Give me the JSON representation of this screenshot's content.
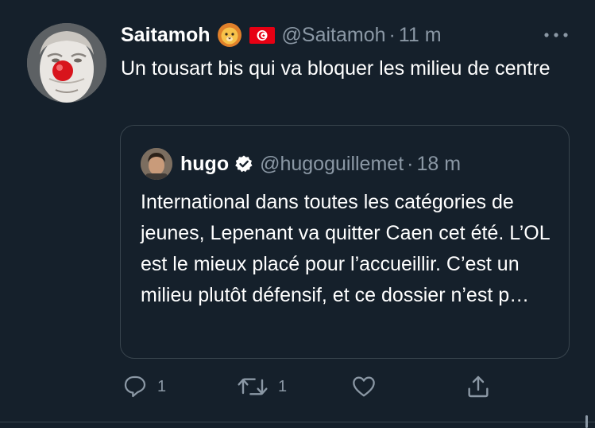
{
  "tweet": {
    "author": {
      "display_name": "Saitamoh",
      "emojis": [
        "lion-face-emoji",
        "tunisia-flag-emoji"
      ],
      "handle": "@Saitamoh",
      "time": "11 m",
      "avatar": "clown-nose-avatar"
    },
    "separator": "·",
    "text": "Un tousart bis qui va bloquer les milieu de centre",
    "more_icon": "more-dots-icon",
    "quoted": {
      "display_name": "hugo",
      "verified": true,
      "handle": "@hugoguillemet",
      "time": "18 m",
      "text": "International dans toutes les catégories de jeunes, Lepenant va quitter Caen cet été. L’OL est le mieux placé pour l’accueillir. C’est un milieu plutôt défensif, et ce dossier n’est p…"
    },
    "actions": {
      "reply": {
        "icon": "reply-icon",
        "count": "1"
      },
      "retweet": {
        "icon": "retweet-icon",
        "count": "1"
      },
      "like": {
        "icon": "heart-icon",
        "count": ""
      },
      "share": {
        "icon": "share-icon"
      }
    }
  },
  "colors": {
    "background": "#15202b",
    "text_primary": "#ffffff",
    "text_secondary": "#8b98a5",
    "border": "#38444d"
  }
}
